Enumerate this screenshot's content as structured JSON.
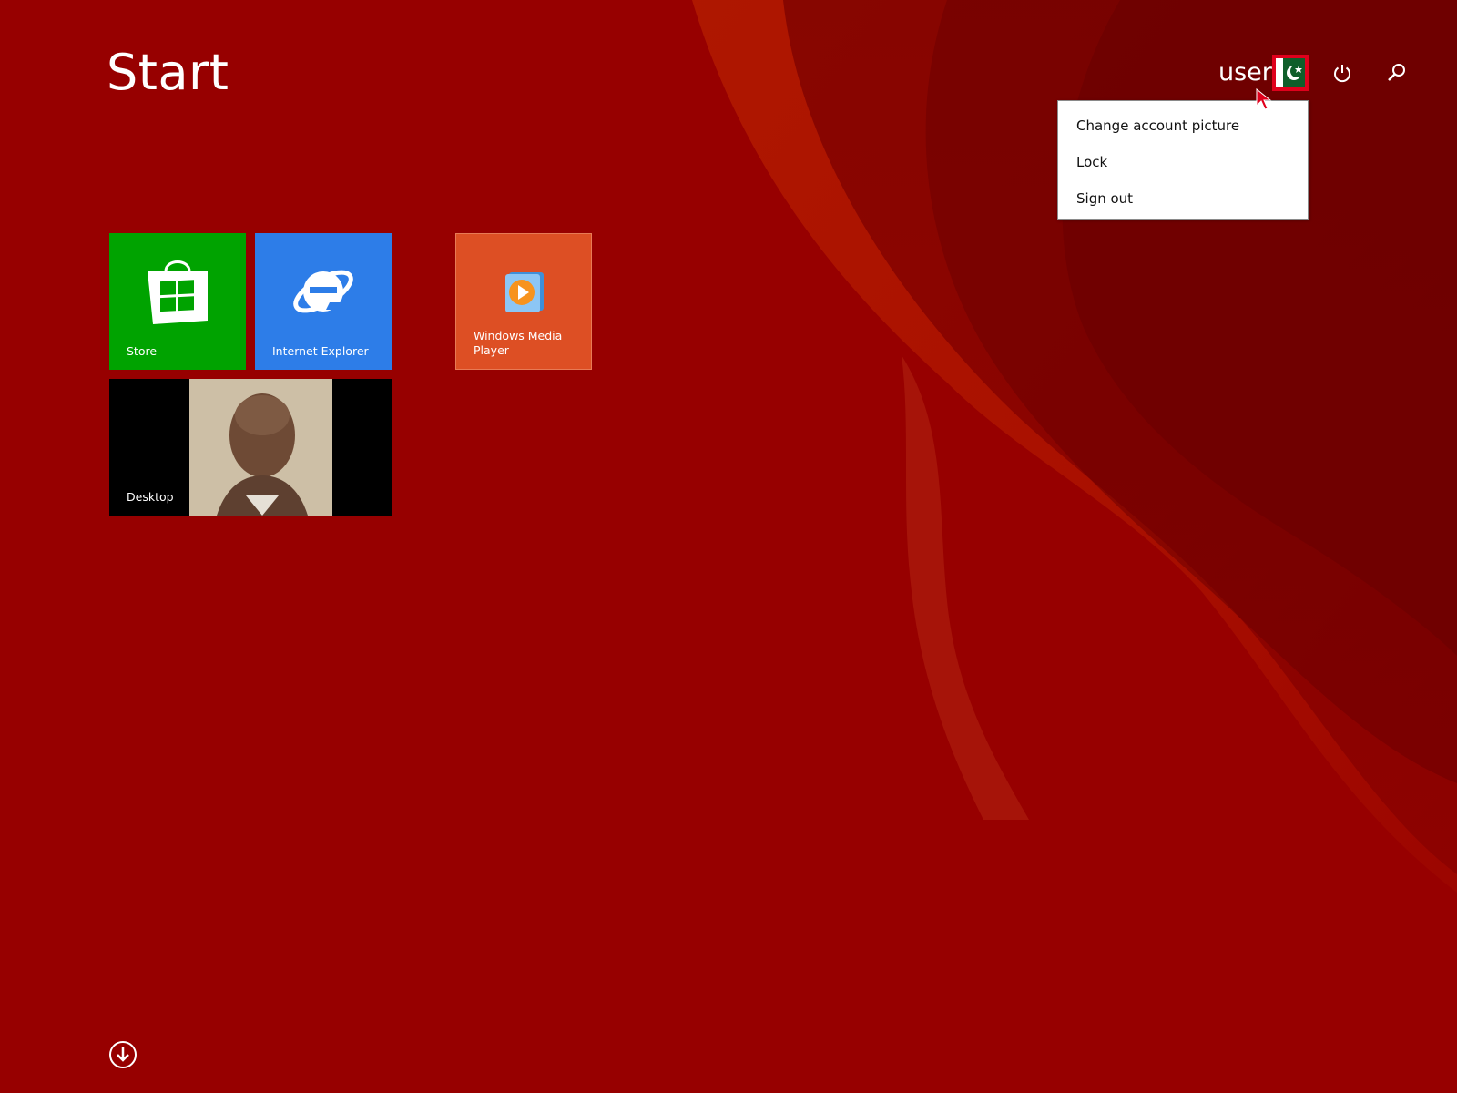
{
  "header": {
    "title": "Start"
  },
  "account": {
    "user_name": "user"
  },
  "account_menu": {
    "items": [
      {
        "label": "Change account picture"
      },
      {
        "label": "Lock"
      },
      {
        "label": "Sign out"
      }
    ]
  },
  "tiles": {
    "store": {
      "label": "Store",
      "color": "#00A300"
    },
    "internet_explorer": {
      "label": "Internet Explorer",
      "color": "#2D7DE8"
    },
    "windows_media_player": {
      "label": "Windows Media Player",
      "color": "#DD4F24"
    },
    "desktop": {
      "label": "Desktop"
    }
  },
  "icons": [
    "power-icon",
    "search-icon",
    "arrow-down-circle-icon",
    "store-bag-icon",
    "internet-explorer-icon",
    "media-player-icon"
  ],
  "colors": {
    "background": "#970000",
    "accent": "#E0001C"
  }
}
